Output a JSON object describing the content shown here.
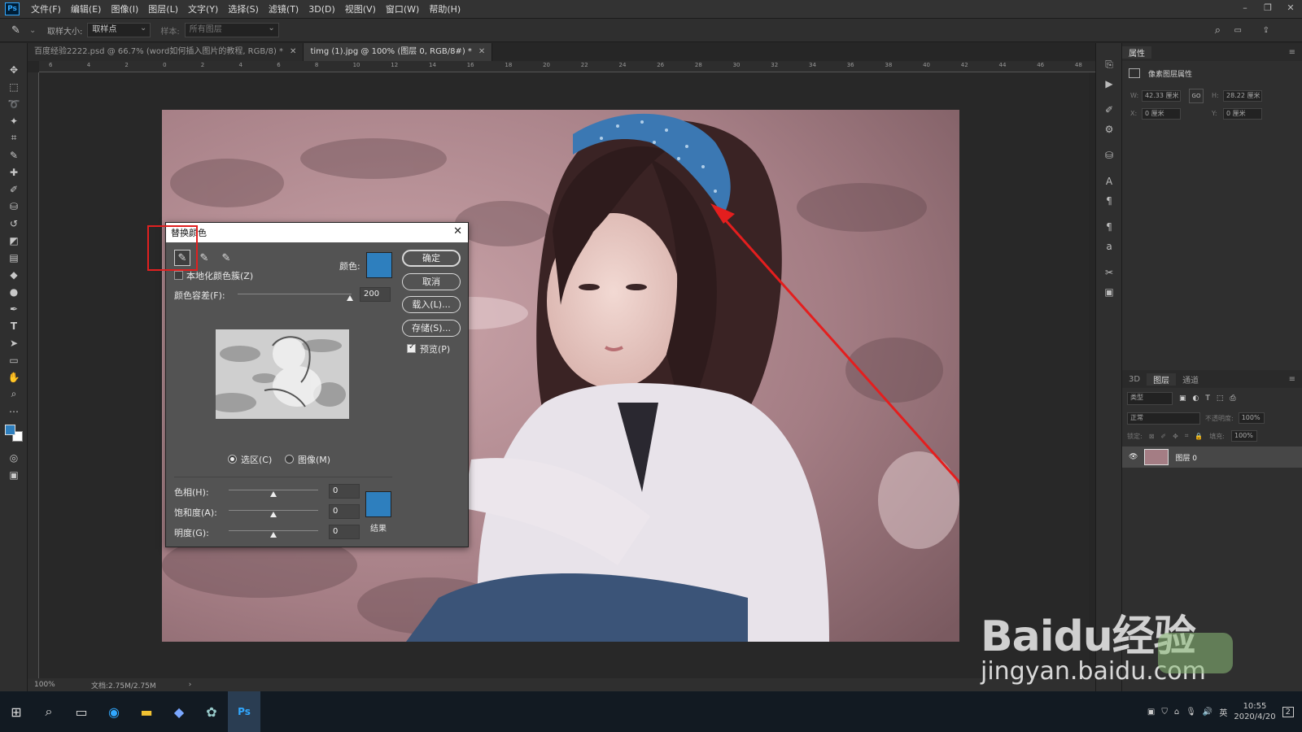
{
  "app": {
    "logo": "Ps"
  },
  "menu": [
    "文件(F)",
    "编辑(E)",
    "图像(I)",
    "图层(L)",
    "文字(Y)",
    "选择(S)",
    "滤镜(T)",
    "3D(D)",
    "视图(V)",
    "窗口(W)",
    "帮助(H)"
  ],
  "options": {
    "sample_size_label": "取样大小:",
    "sample_size_value": "取样点",
    "sample_label": "样本:",
    "sample_value": "所有图层"
  },
  "tabs": [
    {
      "label": "百度经验2222.psd @ 66.7% (word如何插入图片的教程, RGB/8) *",
      "active": false
    },
    {
      "label": "timg (1).jpg @ 100% (图层 0, RGB/8#) *",
      "active": true
    }
  ],
  "ruler_marks": [
    "6",
    "4",
    "2",
    "0",
    "2",
    "4",
    "6",
    "8",
    "10",
    "12",
    "14",
    "16",
    "18",
    "20",
    "22",
    "24",
    "26",
    "28",
    "30",
    "32",
    "34",
    "36",
    "38",
    "40",
    "42",
    "44",
    "46",
    "48"
  ],
  "status": {
    "zoom": "100%",
    "doc": "文档:2.75M/2.75M"
  },
  "properties": {
    "tab": "属性",
    "section": "像素图层属性",
    "w_label": "W:",
    "w_value": "42.33 厘米",
    "link": "GO",
    "h_label": "H:",
    "h_value": "28.22 厘米",
    "x_label": "X:",
    "x_value": "0 厘米",
    "y_label": "Y:",
    "y_value": "0 厘米"
  },
  "layers": {
    "tabs": [
      "3D",
      "图层",
      "通道"
    ],
    "kind": "类型",
    "blend": "正常",
    "opacity_label": "不透明度:",
    "opacity": "100%",
    "lock_label": "锁定:",
    "fill_label": "填充:",
    "fill": "100%",
    "layer_name": "图层 0"
  },
  "dialog": {
    "title": "替换颜色",
    "localized": "本地化颜色簇(Z)",
    "color_label": "颜色:",
    "tolerance_label": "颜色容差(F):",
    "tolerance": "200",
    "ok": "确定",
    "cancel": "取消",
    "load": "载入(L)...",
    "save": "存储(S)...",
    "preview": "预览(P)",
    "radio_selection": "选区(C)",
    "radio_image": "图像(M)",
    "hue_label": "色相(H):",
    "hue": "0",
    "sat_label": "饱和度(A):",
    "sat": "0",
    "light_label": "明度(G):",
    "light": "0",
    "result_label": "结果",
    "swatch_color": "#2e7fbe"
  },
  "taskbar": {
    "time": "10:55",
    "date": "2020/4/20",
    "ime": "英",
    "notif": "2"
  },
  "watermark": {
    "brand": "Baidu经验",
    "url": "jingyan.baidu.com"
  }
}
